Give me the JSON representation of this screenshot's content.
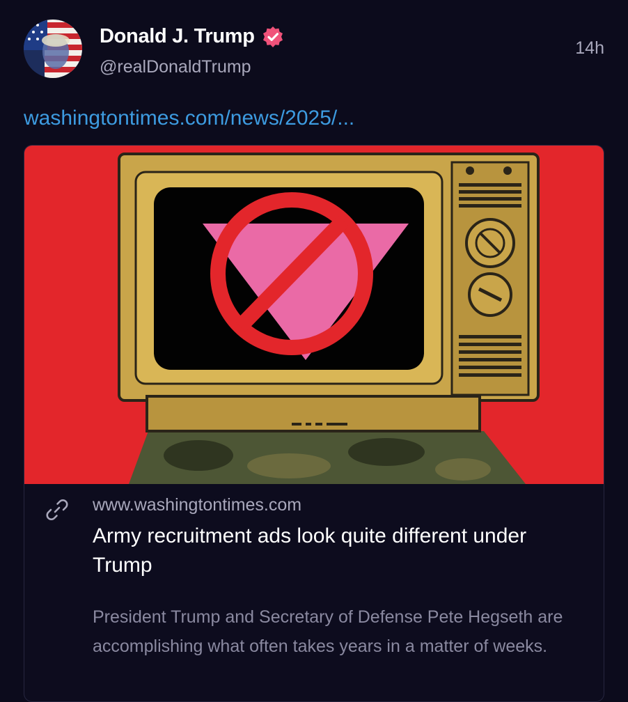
{
  "post": {
    "author_name": "Donald J. Trump",
    "handle": "@realDonaldTrump",
    "time": "14h",
    "link_text": "washingtontimes.com/news/2025/..."
  },
  "card": {
    "domain": "www.washingtontimes.com",
    "title": "Army recruitment ads look quite different under Trump",
    "description": "President Trump and Secretary of Defense Pete Hegseth are accomplishing what often takes years in a matter of weeks."
  },
  "icons": {
    "verified": "verified-badge-icon",
    "link": "link-icon"
  },
  "colors": {
    "background": "#0c0b1c",
    "link": "#3d9be0",
    "verified": "#f0527a",
    "image_background": "#e3262b",
    "secondary_text": "#a9a8bc"
  }
}
